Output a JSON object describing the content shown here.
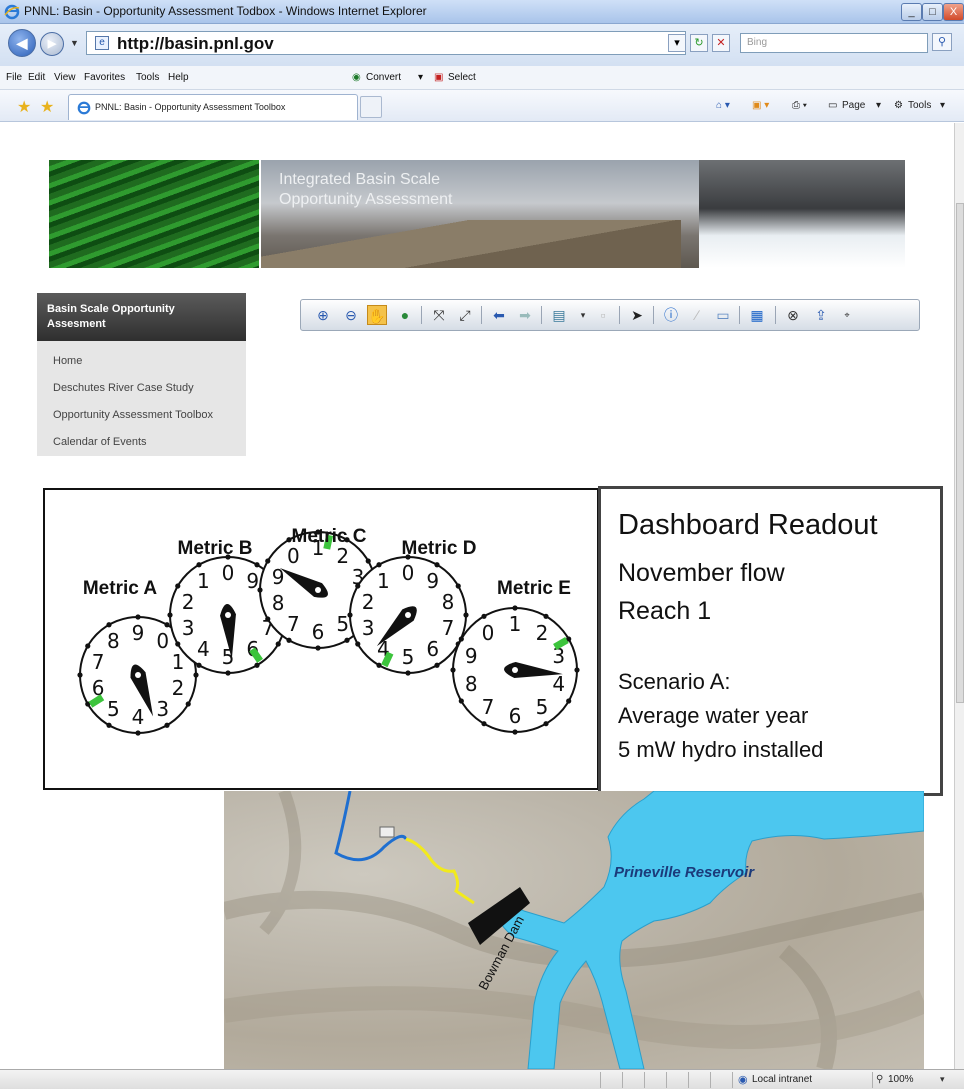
{
  "window": {
    "title": "PNNL: Basin - Opportunity Assessment Todbox - Windows Internet Explorer",
    "controls": [
      "_",
      "□",
      "X"
    ]
  },
  "address": {
    "url": "http://basin.pnl.gov",
    "search_placeholder": "Bing"
  },
  "menu": [
    "File",
    "Edit",
    "View",
    "Favorites",
    "Tools",
    "Help"
  ],
  "menu_extra": {
    "convert": "Convert",
    "select": "Select"
  },
  "tab": {
    "label": "PNNL: Basin - Opportunity Assessment Toolbox"
  },
  "command_bar": {
    "page": "Page",
    "tools": "Tools"
  },
  "banner": {
    "line1": "Integrated Basin Scale",
    "line2": "Opportunity Assessment"
  },
  "sidebar": {
    "heading": "Basin Scale Opportunity Assesment",
    "items": [
      {
        "label": "Home"
      },
      {
        "label": "Deschutes River Case Study"
      },
      {
        "label": "Opportunity Assessment Toolbox"
      },
      {
        "label": "Calendar of Events"
      }
    ]
  },
  "toolbar_icons": [
    "zoom-in-icon",
    "zoom-out-icon",
    "pan-icon",
    "globe-icon",
    "full-extent-icon",
    "fixed-zoom-icon",
    "back-icon",
    "forward-icon",
    "layers-icon",
    "select-icon",
    "pointer-icon",
    "info-icon",
    "measure-icon",
    "comment-icon",
    "print-icon",
    "find-icon",
    "export-icon",
    "xy-icon"
  ],
  "dials": [
    {
      "name": "Metric A",
      "digits": [
        "7",
        "8",
        "9",
        "0",
        "1",
        "2",
        "3",
        "4",
        "5",
        "6"
      ]
    },
    {
      "name": "Metric B",
      "digits": [
        "2",
        "1",
        "0",
        "9",
        "8",
        "7",
        "6",
        "5",
        "4",
        "3"
      ]
    },
    {
      "name": "Metric C",
      "digits": [
        "9",
        "0",
        "1",
        "2",
        "3",
        "4",
        "5",
        "6",
        "7",
        "8"
      ]
    },
    {
      "name": "Metric D",
      "digits": [
        "2",
        "1",
        "0",
        "9",
        "8",
        "7",
        "6",
        "5",
        "4",
        "3"
      ]
    },
    {
      "name": "Metric E",
      "digits": [
        "9",
        "0",
        "1",
        "2",
        "3",
        "4",
        "5",
        "6",
        "7",
        "8"
      ]
    }
  ],
  "readout": {
    "title": "Dashboard Readout",
    "line1": "November flow",
    "line2": "Reach 1",
    "scenario": "Scenario A:",
    "line3": "Average water year",
    "line4": "5 mW hydro installed"
  },
  "map": {
    "reservoir_label": "Prineville Reservoir",
    "dam_label": "Bowman Dam",
    "colors": {
      "water": "#4cc7ef",
      "reach": "#f2ea1c",
      "river": "#1f6fd0"
    }
  },
  "status": {
    "zone": "Local intranet",
    "zoom": "100%"
  },
  "colors": {
    "indicator": "#3cc43c",
    "nav_head": "#3e3e3e"
  }
}
